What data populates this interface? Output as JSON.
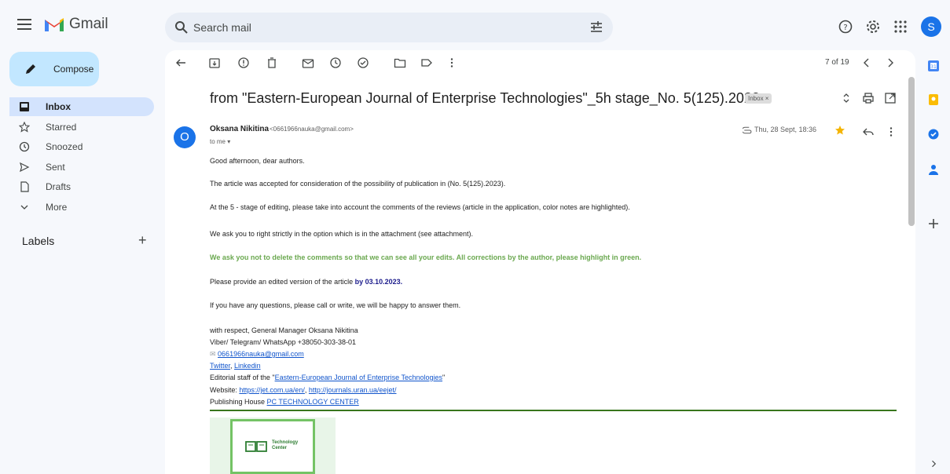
{
  "header": {
    "app_name": "Gmail",
    "search_placeholder": "Search mail",
    "avatar_letter": "S"
  },
  "sidebar": {
    "compose_label": "Compose",
    "items": [
      {
        "label": "Inbox",
        "icon": "inbox-icon",
        "active": true
      },
      {
        "label": "Starred",
        "icon": "star-icon"
      },
      {
        "label": "Snoozed",
        "icon": "clock-icon"
      },
      {
        "label": "Sent",
        "icon": "send-icon"
      },
      {
        "label": "Drafts",
        "icon": "draft-icon"
      },
      {
        "label": "More",
        "icon": "chevron-down-icon"
      }
    ],
    "labels_title": "Labels",
    "labels_add": "+"
  },
  "toolbar": {
    "page_count": "7 of 19"
  },
  "email": {
    "subject": "from \"Eastern-European Journal of Enterprise Technologies\"_5h stage_No. 5(125).2023",
    "label_chip": "Inbox ×",
    "sender_name": "Oksana Nikitina",
    "sender_email": "<0661966nauka@gmail.com>",
    "to": "to me ▾",
    "avatar_letter": "O",
    "date": "Thu, 28 Sept, 18:36",
    "body": {
      "greeting": "Good afternoon, dear authors.",
      "p1": "The article was accepted for consideration of the possibility of publication in (No. 5(125).2023).",
      "p2": "At the 5 - stage of editing, please take into account the comments of the reviews (article in the application, color notes are highlighted).",
      "p3": "We ask you to right strictly in the option which is in the attachment (see attachment).",
      "p4_green": "We ask you not to delete the comments so that we can see all your edits. All corrections by the author, please highlight in green.",
      "p5_prefix": "Please provide an edited version of the article ",
      "p5_date": "by 03.10.2023.",
      "p6": "If you have any questions, please call or write, we will be happy to answer them.",
      "sig_1": "with respect, General Manager Oksana Nikitina",
      "sig_2": "Viber/ Telegram/ WhatsApp  +38050-303-38-01",
      "sig_email": "0661966nauka@gmail.com",
      "sig_twitter": "Twitter",
      "sig_comma": ",",
      "sig_linkedin": "Linkedin",
      "sig_editorial_prefix": "Editorial staff of the \"",
      "sig_editorial_link": "Eastern-European  Journal of Enterprise Technologies",
      "sig_editorial_suffix": "\"",
      "sig_website_prefix": "Website: ",
      "sig_website_1": "https://jet.com.ua/en/",
      "sig_website_sep": ", ",
      "sig_website_2": "http://journals.uran.ua/eejet/",
      "sig_publisher_prefix": "Publishing House ",
      "sig_publisher_link": "PC TECHNOLOGY CENTER",
      "logo_text_1": "Technology",
      "logo_text_2": "Center"
    }
  },
  "colors": {
    "accent": "#1a73e8",
    "green_text": "#6aa84f",
    "star": "#f4b400"
  }
}
